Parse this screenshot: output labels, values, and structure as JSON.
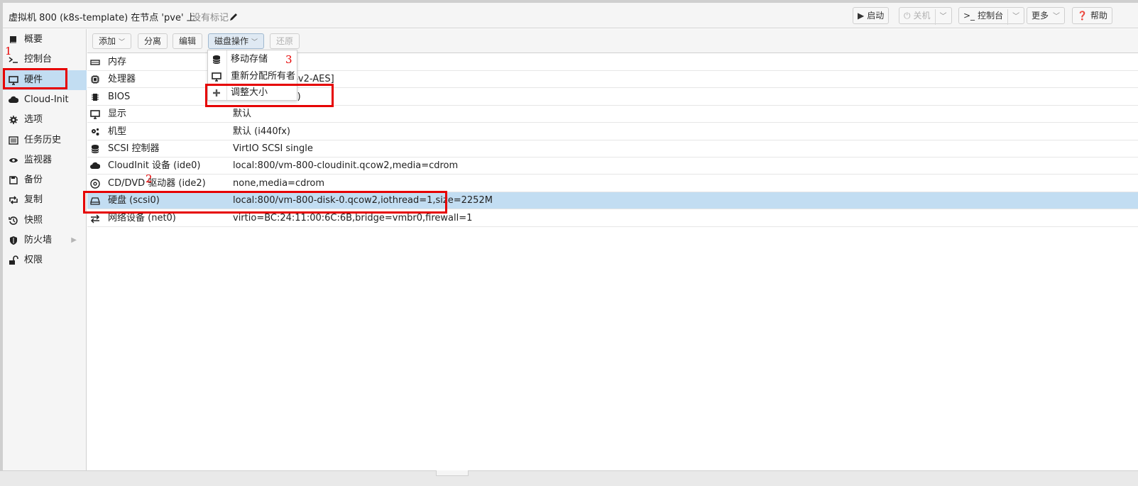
{
  "header": {
    "title": "虚拟机 800 (k8s-template) 在节点 'pve' 上",
    "tags_label": "没有标记",
    "start_label": "启动",
    "shutdown_label": "关机",
    "console_label": "控制台",
    "more_label": "更多",
    "help_label": "帮助"
  },
  "sidebar": {
    "items": [
      {
        "label": "概要",
        "icon": "book-icon"
      },
      {
        "label": "控制台",
        "icon": "terminal-icon"
      },
      {
        "label": "硬件",
        "icon": "monitor-icon",
        "selected": true
      },
      {
        "label": "Cloud-Init",
        "icon": "cloud-icon"
      },
      {
        "label": "选项",
        "icon": "gear-icon"
      },
      {
        "label": "任务历史",
        "icon": "list-icon"
      },
      {
        "label": "监视器",
        "icon": "eye-icon"
      },
      {
        "label": "备份",
        "icon": "floppy-icon"
      },
      {
        "label": "复制",
        "icon": "retweet-icon"
      },
      {
        "label": "快照",
        "icon": "history-icon"
      },
      {
        "label": "防火墙",
        "icon": "shield-icon"
      },
      {
        "label": "权限",
        "icon": "unlock-icon"
      }
    ]
  },
  "toolbar": {
    "add_label": "添加",
    "detach_label": "分离",
    "edit_label": "编辑",
    "disk_action_label": "磁盘操作",
    "revert_label": "还原"
  },
  "disk_menu": {
    "items": [
      {
        "label": "移动存储",
        "icon": "database-icon"
      },
      {
        "label": "重新分配所有者",
        "icon": "desktop-icon"
      },
      {
        "label": "调整大小",
        "icon": "plus-icon"
      }
    ]
  },
  "hardware": {
    "rows": [
      {
        "name": "内存",
        "value": "",
        "icon": "memory-icon"
      },
      {
        "name": "处理器",
        "value": "ores) [x86-64-v2-AES]",
        "icon": "cpu-icon"
      },
      {
        "name": "BIOS",
        "value": "默认 (SeaBIOS)",
        "icon": "chip-icon"
      },
      {
        "name": "显示",
        "value": "默认",
        "icon": "desktop-icon"
      },
      {
        "name": "机型",
        "value": "默认 (i440fx)",
        "icon": "cogs-icon"
      },
      {
        "name": "SCSI 控制器",
        "value": "VirtIO SCSI single",
        "icon": "database-icon"
      },
      {
        "name": "CloudInit 设备 (ide0)",
        "value": "local:800/vm-800-cloudinit.qcow2,media=cdrom",
        "icon": "cloud-icon"
      },
      {
        "name": "CD/DVD 驱动器 (ide2)",
        "value": "none,media=cdrom",
        "icon": "cdrom-icon"
      },
      {
        "name": "硬盘 (scsi0)",
        "value": "local:800/vm-800-disk-0.qcow2,iothread=1,size=2252M",
        "icon": "hdd-icon",
        "selected": true
      },
      {
        "name": "网络设备 (net0)",
        "value": "virtio=BC:24:11:00:6C:6B,bridge=vmbr0,firewall=1",
        "icon": "exchange-icon"
      }
    ]
  },
  "annotations": {
    "step1": "1",
    "step2": "2",
    "step3": "3",
    "color": "#e60000"
  },
  "colors": {
    "selection": "#c2ddf2",
    "panel": "#f5f5f5"
  }
}
